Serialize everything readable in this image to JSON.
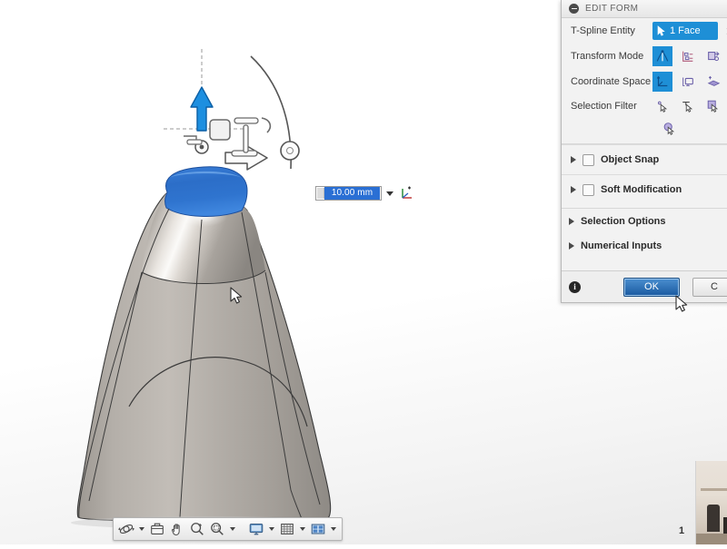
{
  "app": {
    "viewport_background": "#ffffff",
    "accent_blue": "#1e8fd6",
    "selected_face_color": "#2a6fc4",
    "model_surface_color": "#a7a29c"
  },
  "gizmo": {
    "arrow_up_color": "#1d8fe0",
    "handles": [
      "translate-up-arrow",
      "translate-right-arrow",
      "rotate-arc-handle",
      "scale-box-handle",
      "pivot-handle"
    ]
  },
  "value_input": {
    "value": "10.00 mm",
    "dropdown_icon": "chevron-down-icon",
    "axis_icon": "coordinate-axis-icon"
  },
  "nav_toolbar": {
    "buttons": [
      {
        "name": "orbit-icon",
        "glyph": "orbit",
        "has_caret": true
      },
      {
        "name": "look-at-icon",
        "glyph": "look-at",
        "has_caret": false
      },
      {
        "name": "pan-icon",
        "glyph": "pan",
        "has_caret": false
      },
      {
        "name": "zoom-icon",
        "glyph": "zoom",
        "has_caret": false
      },
      {
        "name": "zoom-window-icon",
        "glyph": "zoom-window",
        "has_caret": true
      },
      {
        "name": "display-settings-icon",
        "glyph": "display",
        "has_caret": true
      },
      {
        "name": "grid-snap-icon",
        "glyph": "grid",
        "has_caret": true
      },
      {
        "name": "viewports-icon",
        "glyph": "viewports",
        "has_caret": true
      }
    ]
  },
  "edit_form": {
    "title": "EDIT FORM",
    "collapse_icon": "collapse-minus-icon",
    "rows": [
      {
        "label": "T-Spline Entity",
        "selection_label": "1 Face",
        "selection_icon": "cursor-arrow-icon",
        "close_icon": "close-x-icon"
      },
      {
        "label": "Transform Mode",
        "icons": [
          {
            "name": "transform-move-icon",
            "active": true
          },
          {
            "name": "transform-edit-icon",
            "active": false
          },
          {
            "name": "transform-modify-icon",
            "active": false
          }
        ]
      },
      {
        "label": "Coordinate Space",
        "icons": [
          {
            "name": "coordinate-world-icon",
            "active": true
          },
          {
            "name": "coordinate-view-icon",
            "active": false
          },
          {
            "name": "coordinate-local-icon",
            "active": false
          }
        ]
      },
      {
        "label": "Selection Filter",
        "icons": [
          {
            "name": "filter-vertex-icon",
            "active": false
          },
          {
            "name": "filter-edge-icon",
            "active": false
          },
          {
            "name": "filter-face-icon",
            "active": false
          },
          {
            "name": "filter-body-icon",
            "active": false
          }
        ]
      }
    ],
    "groups": [
      {
        "label": "Object Snap",
        "expander_icon": "expander-triangle-icon",
        "checkbox": "unchecked"
      },
      {
        "label": "Soft Modification",
        "expander_icon": "expander-triangle-icon",
        "checkbox": "unchecked"
      }
    ],
    "simple_groups": [
      {
        "label": "Selection Options",
        "expander_icon": "expander-triangle-icon"
      },
      {
        "label": "Numerical Inputs",
        "expander_icon": "expander-triangle-icon"
      }
    ],
    "footer": {
      "info_icon": "info-icon",
      "info_glyph": "i",
      "ok_label": "OK",
      "cancel_label": "C"
    }
  },
  "webcam": {
    "number_label": "1"
  }
}
